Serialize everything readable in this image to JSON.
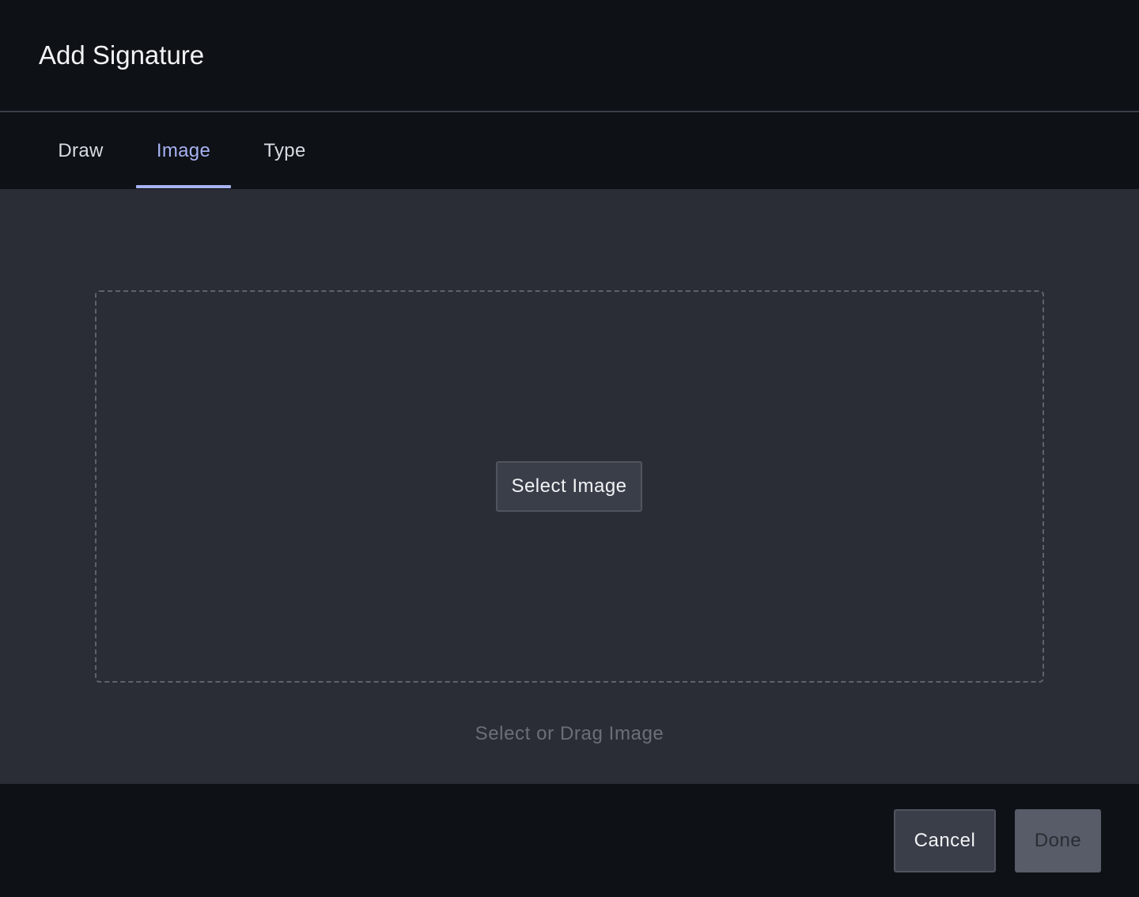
{
  "dialog": {
    "title": "Add Signature"
  },
  "tabs": [
    {
      "label": "Draw",
      "active": false
    },
    {
      "label": "Image",
      "active": true
    },
    {
      "label": "Type",
      "active": false
    }
  ],
  "dropzone": {
    "select_button_label": "Select Image",
    "hint": "Select or Drag Image"
  },
  "footer": {
    "cancel_label": "Cancel",
    "done_label": "Done",
    "done_disabled": true
  },
  "colors": {
    "background": "#0e1116",
    "content_background": "#2a2d36",
    "accent": "#a7b2f2",
    "button_background": "#3a3e49",
    "disabled_button": "#585c68"
  }
}
